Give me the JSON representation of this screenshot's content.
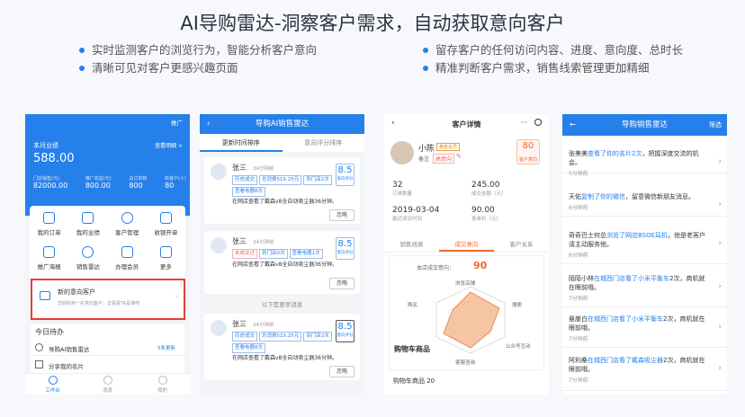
{
  "title": "AI导购雷达-洞察客户需求，自动获取意向客户",
  "bullets_left": [
    "实时监测客户的浏览行为，智能分析客户意向",
    "清晰可见对客户更感兴趣页面"
  ],
  "bullets_right": [
    "留存客户的任何访问内容、进度、意向度、总时长",
    "精准判断客户需求，销售线索管理更加精细"
  ],
  "p1": {
    "promote": "推广",
    "month_label": "本月业绩",
    "view_detail": "查看明细 >",
    "amount": "588.00",
    "stats": [
      {
        "label": "门店销售(元)",
        "value": "82000.00"
      },
      {
        "label": "推广收益(元)",
        "value": "800.00"
      },
      {
        "label": "总订单数",
        "value": "800"
      },
      {
        "label": "新客户(人)",
        "value": "80"
      }
    ],
    "grid": [
      "我的订单",
      "我的业绩",
      "客户管理",
      "收银开单",
      "推广海报",
      "销售雷达",
      "办理会员",
      "更多"
    ],
    "new_title": "新的意向客户",
    "new_sub": "您获取到一名意向客户，去看看TA是谁吧",
    "today": "今日待办",
    "radar": "导购AI销售雷达",
    "radar_badge": "5条更新",
    "share": "分享我的名片",
    "tabs": [
      "工作台",
      "消息",
      "我的"
    ]
  },
  "p2": {
    "title": "导购AI销售雷达",
    "tab1": "更新时间排序",
    "tab2": "意向评分排序",
    "more": "以下是更早消息",
    "ignore": "忽略",
    "cards": [
      {
        "name": "张三",
        "time": "34分钟前",
        "tags": [
          "历史成交",
          "总消费515.25元",
          "到门店2次"
        ],
        "tag2": "查看电器8次",
        "score": "8.5",
        "score_label": "意向评分",
        "text": "在网店查看了戴森v8全自动吸尘器36分钟。"
      },
      {
        "name": "张三",
        "time": "34分钟前",
        "tags": [
          "未成交过",
          "到门店0次",
          "查看电器1次"
        ],
        "tag2": "",
        "score": "8.5",
        "score_label": "意向评分",
        "text": "在网店查看了戴森v8全自动吸尘器36分钟。"
      },
      {
        "name": "张三",
        "time": "34分钟前",
        "tags": [
          "历史成交",
          "总消费515.25元",
          "到门店2次"
        ],
        "tag2": "查看电器8次",
        "score": "8.5",
        "score_label": "意向评分",
        "text": "在网店查看了戴森v8全自动吸尘器36分钟。"
      }
    ]
  },
  "p3": {
    "title": "客户详情",
    "name": "小陈",
    "badge": "黄金会员",
    "note_label": "备注",
    "note": "高意向",
    "score": "80",
    "score_label": "客户意向",
    "stats": [
      {
        "value": "32",
        "label": "订单数量"
      },
      {
        "value": "245.00",
        "label": "成交金额（元）"
      },
      {
        "value": "2019-03-04",
        "label": "最近成交时间"
      },
      {
        "value": "90.00",
        "label": "客单价（元）"
      }
    ],
    "tabs": [
      "销售线索",
      "成交意向",
      "客户关系"
    ],
    "intent_label": "本店成交意向：",
    "intent": "90",
    "radar": [
      "浏览店铺",
      "搜索",
      "公众号互动",
      "客服咨询",
      "购物车商品",
      "购买"
    ],
    "radar_highlight": "购物车商品",
    "cart": "购物车商品 20"
  },
  "p4": {
    "title": "导购销售雷达",
    "filter": "筛选",
    "items": [
      {
        "pre": "张美美",
        "link": "查看了你的名片2次",
        "post": "，把握深度交流的机会。",
        "time": "5分钟前"
      },
      {
        "pre": "天佑",
        "link": "复制了你的微信",
        "post": "，留意微信新朋友消息。",
        "time": "6分钟前"
      },
      {
        "pre": "奇奇巴士何总",
        "link": "浏览了网店BSOE耳机",
        "post": "，他是老客户请主动服务他。",
        "time": "6分钟前"
      },
      {
        "pre": "陌陌小林",
        "link": "在城西门店看了小米平衡车",
        "post": "2次，商机就在眼前哦。",
        "time": "7分钟前"
      },
      {
        "pre": "悬崖白",
        "link": "在城西门店看了小米平衡车",
        "post": "2次，商机就在眼前哦。",
        "time": "7分钟前"
      },
      {
        "pre": "阿利桑",
        "link": "在城西门店看了戴森吸尘器",
        "post": "2次，商机就在眼前哦。",
        "time": "7分钟前"
      }
    ]
  }
}
